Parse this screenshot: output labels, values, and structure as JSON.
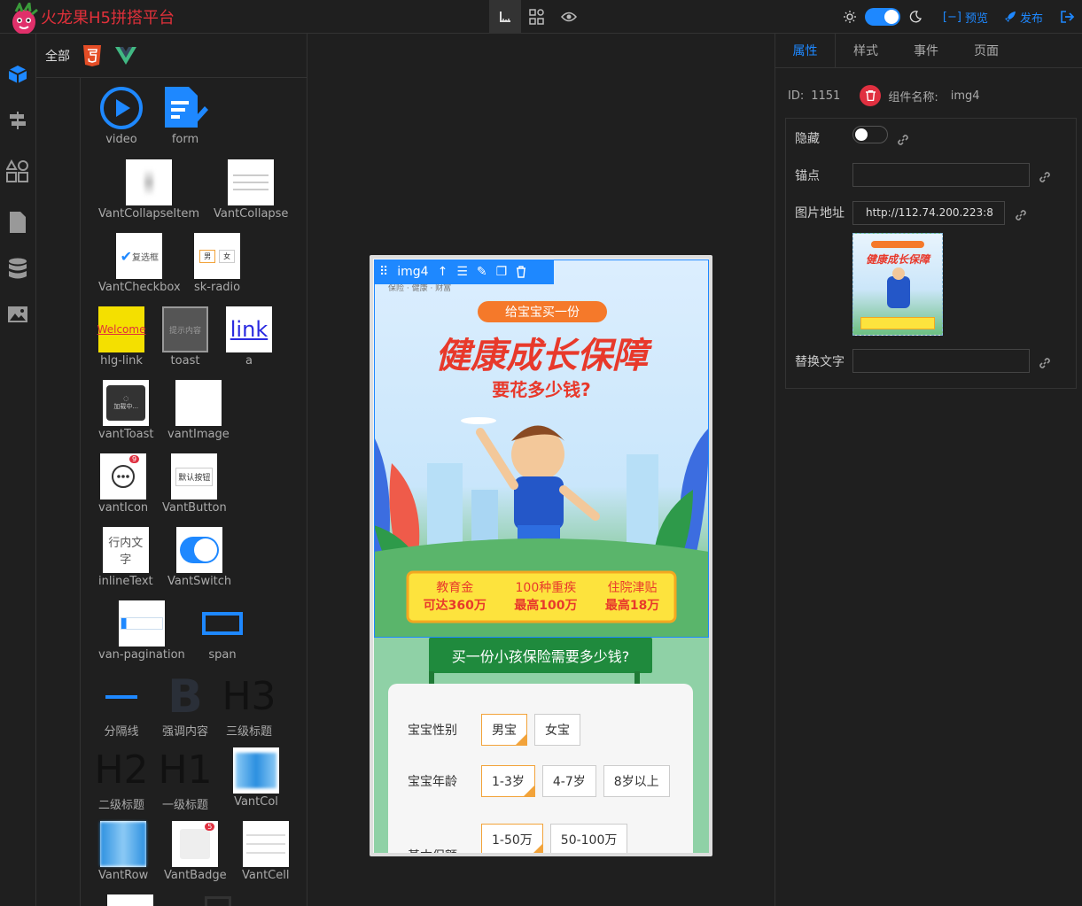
{
  "topbar": {
    "title": "火龙果H5拼搭平台",
    "preview_label": "预览",
    "publish_label": "发布"
  },
  "comp_panel": {
    "tab_all": "全部",
    "components": [
      {
        "label": "video"
      },
      {
        "label": "form"
      },
      {
        "label": "VantCollapseItem"
      },
      {
        "label": "VantCollapse"
      },
      {
        "label": "VantCheckbox"
      },
      {
        "label": "sk-radio"
      },
      {
        "label": "hlg-link"
      },
      {
        "label": "toast"
      },
      {
        "label": "a"
      },
      {
        "label": "vantToast"
      },
      {
        "label": "vantImage"
      },
      {
        "label": "vantIcon"
      },
      {
        "label": "VantButton"
      },
      {
        "label": "inlineText"
      },
      {
        "label": "VantSwitch"
      },
      {
        "label": "van-pagination"
      },
      {
        "label": "span"
      },
      {
        "label": "分隔线"
      },
      {
        "label": "强调内容"
      },
      {
        "label": "三级标题"
      },
      {
        "label": "二级标题"
      },
      {
        "label": "一级标题"
      },
      {
        "label": "VantCol"
      },
      {
        "label": "VantRow"
      },
      {
        "label": "VantBadge"
      },
      {
        "label": "VantCell"
      }
    ],
    "thumb_text": {
      "welcome": "Welcome",
      "link": "link",
      "checkbox": "复选框",
      "button": "默认按钮",
      "inline": "行内文字",
      "icon_badge": "9",
      "badge": "5",
      "toast_loading": "加载中...",
      "toast_box": "提示内容",
      "radio_male": "男",
      "radio_female": "女",
      "h3": "H3",
      "h2": "H2",
      "h1": "H1",
      "bold": "B"
    }
  },
  "canvas": {
    "selected_name": "img4",
    "banner": {
      "top_tag": "给宝宝买一份",
      "headline": "健康成长保障",
      "subline": "要花多少钱?",
      "feature1_title": "教育金",
      "feature1_value": "可达360万",
      "feature2_title": "100种重疾",
      "feature2_value": "最高100万",
      "feature3_title": "住院津贴",
      "feature3_value": "最高18万",
      "brand_line": "保险 · 健康 · 财富"
    },
    "section_title": "买一份小孩保险需要多少钱?",
    "rows": [
      {
        "label": "宝宝性别",
        "options": [
          "男宝",
          "女宝"
        ],
        "selected": 0
      },
      {
        "label": "宝宝年龄",
        "options": [
          "1-3岁",
          "4-7岁",
          "8岁以上"
        ],
        "selected": 0
      },
      {
        "label": "基本保额",
        "options": [
          "1-50万",
          "50-100万"
        ],
        "selected": 0
      }
    ]
  },
  "props": {
    "tabs": [
      "属性",
      "样式",
      "事件",
      "页面"
    ],
    "id_label": "ID:",
    "id_value": "1151",
    "name_label": "组件名称:",
    "name_value": "img4",
    "hide_label": "隐藏",
    "anchor_label": "锚点",
    "anchor_value": "",
    "src_label": "图片地址",
    "src_value": "http://112.74.200.223:8",
    "alt_label": "替换文字",
    "alt_value": ""
  },
  "colors": {
    "accent": "#1e88ff",
    "brand_red": "#e0303a",
    "option_orange": "#f2a33a"
  }
}
